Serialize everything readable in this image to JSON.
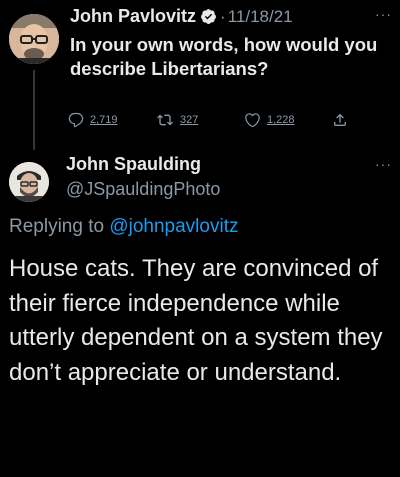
{
  "parent_tweet": {
    "author_name": "John Pavlovitz",
    "separator": "·",
    "date": "11/18/21",
    "text": "In your own words, how would you describe Libertarians?",
    "more": "···",
    "actions": {
      "replies": "2,719",
      "retweets": "327",
      "likes": "1,228"
    }
  },
  "reply_tweet": {
    "author_name": "John Spaulding",
    "handle": "@JSpauldingPhoto",
    "more": "···",
    "replying_prefix": "Replying to",
    "replying_to": "@johnpavlovitz",
    "text": "House cats. They are convinced of their fierce independence while utterly dependent on a system they don’t appreciate or understand."
  },
  "colors": {
    "background": "#000000",
    "text": "#e7e9ea",
    "secondary": "#8b98a5",
    "link": "#1d9bf0",
    "verified": "#e7e9ea"
  }
}
